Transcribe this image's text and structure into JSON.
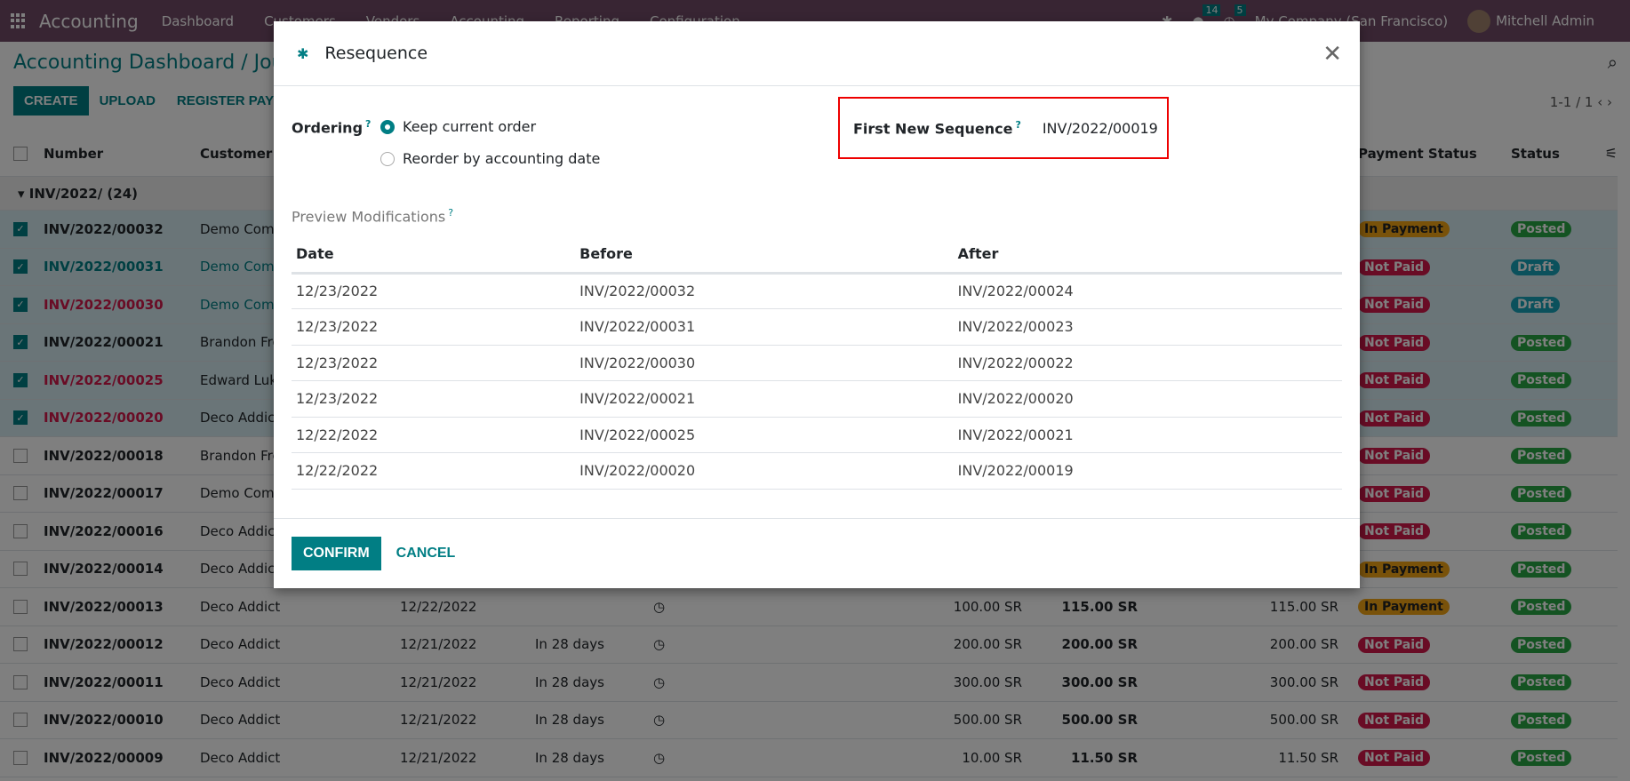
{
  "topbar": {
    "app_name": "Accounting",
    "menu": [
      "Dashboard",
      "Customers",
      "Vendors",
      "Accounting",
      "Reporting",
      "Configuration"
    ],
    "messages_count": "14",
    "activities_count": "5",
    "company": "My Company (San Francisco)",
    "user": "Mitchell Admin"
  },
  "breadcrumb": "Accounting Dashboard / Journal Entries",
  "toolbar": {
    "create": "CREATE",
    "upload": "UPLOAD",
    "register_payment": "REGISTER PAYMENT"
  },
  "pager": "1-1 / 1",
  "list": {
    "headers": {
      "number": "Number",
      "customer": "Customer",
      "payment_status": "Payment Status",
      "status": "Status"
    },
    "group": "INV/2022/ (24)",
    "rows": [
      {
        "number": "INV/2022/00032",
        "customer": "Demo Company",
        "payment": "In Payment",
        "pay_cls": "inpay",
        "status": "Posted",
        "st_cls": "posted",
        "selected": true,
        "num_cls": "",
        "cust_cls": ""
      },
      {
        "number": "INV/2022/00031",
        "customer": "Demo Company",
        "payment": "Not Paid",
        "pay_cls": "notpaid",
        "status": "Draft",
        "st_cls": "draft",
        "selected": true,
        "num_cls": "t-blue",
        "cust_cls": "t-blue"
      },
      {
        "number": "INV/2022/00030",
        "customer": "Demo Company",
        "payment": "Not Paid",
        "pay_cls": "notpaid",
        "status": "Draft",
        "st_cls": "draft",
        "selected": true,
        "num_cls": "t-red",
        "cust_cls": "t-blue"
      },
      {
        "number": "INV/2022/00021",
        "customer": "Brandon Freeman",
        "payment": "Not Paid",
        "pay_cls": "notpaid",
        "status": "Posted",
        "st_cls": "posted",
        "selected": true,
        "num_cls": "",
        "cust_cls": ""
      },
      {
        "number": "INV/2022/00025",
        "customer": "Edward Lukas",
        "payment": "Not Paid",
        "pay_cls": "notpaid",
        "status": "Posted",
        "st_cls": "posted",
        "selected": true,
        "num_cls": "t-red",
        "cust_cls": ""
      },
      {
        "number": "INV/2022/00020",
        "customer": "Deco Addict",
        "payment": "Not Paid",
        "pay_cls": "notpaid",
        "status": "Posted",
        "st_cls": "posted",
        "selected": true,
        "num_cls": "t-red",
        "cust_cls": ""
      },
      {
        "number": "INV/2022/00018",
        "customer": "Brandon Freeman",
        "payment": "Not Paid",
        "pay_cls": "notpaid",
        "status": "Posted",
        "st_cls": "posted",
        "selected": false,
        "num_cls": "",
        "cust_cls": ""
      },
      {
        "number": "INV/2022/00017",
        "customer": "Demo Company",
        "payment": "Not Paid",
        "pay_cls": "notpaid",
        "status": "Posted",
        "st_cls": "posted",
        "selected": false,
        "num_cls": "",
        "cust_cls": ""
      },
      {
        "number": "INV/2022/00016",
        "customer": "Deco Addict",
        "payment": "Not Paid",
        "pay_cls": "notpaid",
        "status": "Posted",
        "st_cls": "posted",
        "selected": false,
        "num_cls": "",
        "cust_cls": ""
      },
      {
        "number": "INV/2022/00014",
        "customer": "Deco Addict",
        "payment": "In Payment",
        "pay_cls": "inpay",
        "status": "Posted",
        "st_cls": "posted",
        "selected": false,
        "num_cls": "",
        "cust_cls": ""
      },
      {
        "number": "INV/2022/00013",
        "customer": "Deco Addict",
        "date": "12/22/2022",
        "due": "",
        "untaxed": "100.00 SR",
        "total": "115.00 SR",
        "residual": "115.00 SR",
        "payment": "In Payment",
        "pay_cls": "inpay",
        "status": "Posted",
        "st_cls": "posted",
        "selected": false,
        "num_cls": "",
        "cust_cls": ""
      },
      {
        "number": "INV/2022/00012",
        "customer": "Deco Addict",
        "date": "12/21/2022",
        "due": "In 28 days",
        "untaxed": "200.00 SR",
        "total": "200.00 SR",
        "residual": "200.00 SR",
        "payment": "Not Paid",
        "pay_cls": "notpaid",
        "status": "Posted",
        "st_cls": "posted",
        "selected": false,
        "num_cls": "",
        "cust_cls": ""
      },
      {
        "number": "INV/2022/00011",
        "customer": "Deco Addict",
        "date": "12/21/2022",
        "due": "In 28 days",
        "untaxed": "300.00 SR",
        "total": "300.00 SR",
        "residual": "300.00 SR",
        "payment": "Not Paid",
        "pay_cls": "notpaid",
        "status": "Posted",
        "st_cls": "posted",
        "selected": false,
        "num_cls": "",
        "cust_cls": ""
      },
      {
        "number": "INV/2022/00010",
        "customer": "Deco Addict",
        "date": "12/21/2022",
        "due": "In 28 days",
        "untaxed": "500.00 SR",
        "total": "500.00 SR",
        "residual": "500.00 SR",
        "payment": "Not Paid",
        "pay_cls": "notpaid",
        "status": "Posted",
        "st_cls": "posted",
        "selected": false,
        "num_cls": "",
        "cust_cls": ""
      },
      {
        "number": "INV/2022/00009",
        "customer": "Deco Addict",
        "date": "12/21/2022",
        "due": "In 28 days",
        "untaxed": "10.00 SR",
        "total": "11.50 SR",
        "residual": "11.50 SR",
        "payment": "Not Paid",
        "pay_cls": "notpaid",
        "status": "Posted",
        "st_cls": "posted",
        "selected": false,
        "num_cls": "",
        "cust_cls": ""
      }
    ]
  },
  "modal": {
    "title": "Resequence",
    "ordering_label": "Ordering",
    "options": [
      {
        "label": "Keep current order",
        "selected": true
      },
      {
        "label": "Reorder by accounting date",
        "selected": false
      }
    ],
    "first_new_sequence_label": "First New Sequence",
    "first_new_sequence_value": "INV/2022/00019",
    "preview_label": "Preview Modifications",
    "columns": [
      "Date",
      "Before",
      "After"
    ],
    "rows": [
      [
        "12/23/2022",
        "INV/2022/00032",
        "INV/2022/00024"
      ],
      [
        "12/23/2022",
        "INV/2022/00031",
        "INV/2022/00023"
      ],
      [
        "12/23/2022",
        "INV/2022/00030",
        "INV/2022/00022"
      ],
      [
        "12/23/2022",
        "INV/2022/00021",
        "INV/2022/00020"
      ],
      [
        "12/22/2022",
        "INV/2022/00025",
        "INV/2022/00021"
      ],
      [
        "12/22/2022",
        "INV/2022/00020",
        "INV/2022/00019"
      ]
    ],
    "confirm": "CONFIRM",
    "cancel": "CANCEL"
  }
}
